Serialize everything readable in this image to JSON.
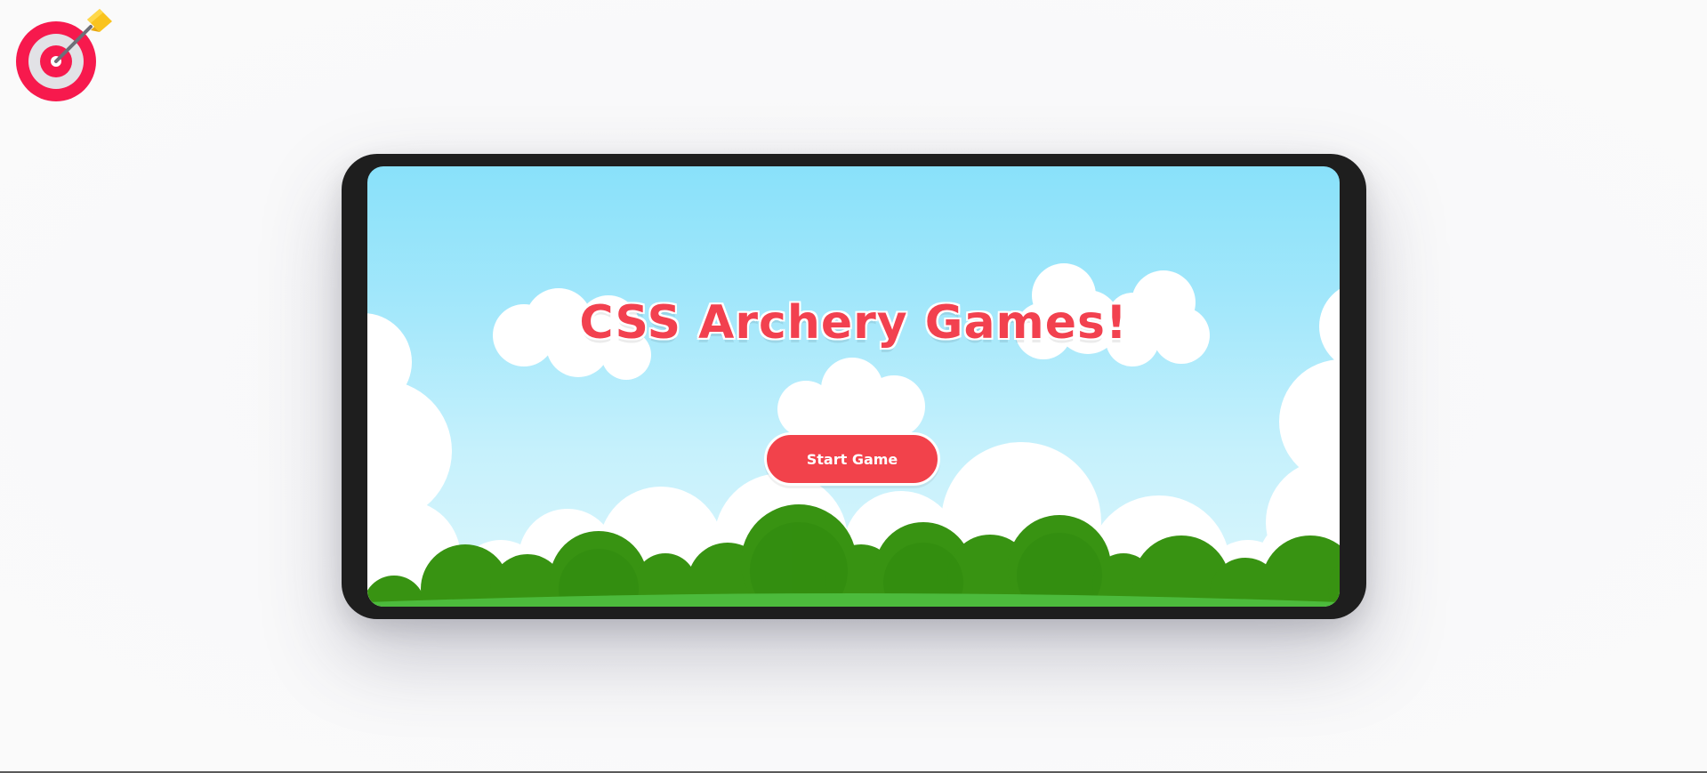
{
  "app": {
    "logo_icon": "archery-target-icon"
  },
  "game": {
    "title": "CSS Archery Games!",
    "start_label": "Start Game"
  },
  "colors": {
    "title": "#f2414f",
    "button": "#f2424b",
    "sky_top": "#89e1fa",
    "sky_bottom": "#dcf6fd",
    "bush_dark": "#2f8a0e",
    "bush_light": "#3fa21a",
    "grass": "#4cbb3c",
    "device_frame": "#1e1e1e"
  }
}
